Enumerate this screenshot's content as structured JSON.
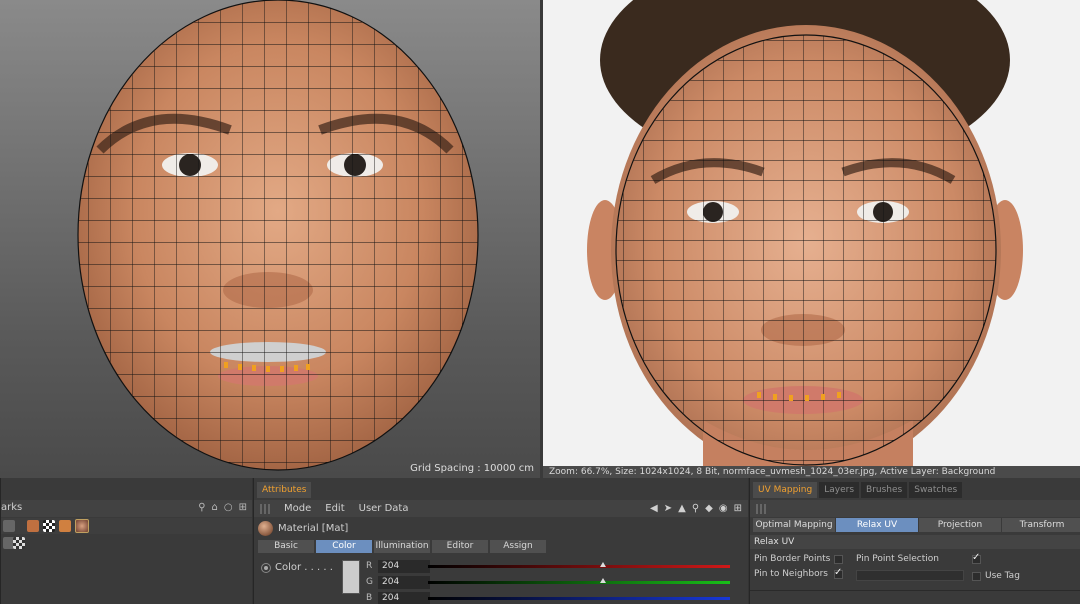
{
  "viewport_left": {
    "grid_spacing": "Grid Spacing : 10000 cm"
  },
  "statusbar": {
    "text": "Zoom: 66.7%, Size: 1024x1024, 8 Bit, normface_uvmesh_1024_03er.jpg, Active Layer: Background"
  },
  "left_panel": {
    "label": "arks"
  },
  "attributes": {
    "tab": "Attributes",
    "menu": [
      "Mode",
      "Edit",
      "User Data"
    ],
    "material": "Material [Mat]",
    "tabs": [
      "Basic",
      "Color",
      "Illumination",
      "Editor",
      "Assign"
    ],
    "selected_tab": "Color",
    "color_label": "Color . . . . .",
    "channels": [
      {
        "name": "R",
        "value": "204",
        "color": "#d01818"
      },
      {
        "name": "G",
        "value": "204",
        "color": "#18c018"
      },
      {
        "name": "B",
        "value": "204",
        "color": "#1838d8"
      }
    ]
  },
  "uv_panel": {
    "tabs": [
      "UV Mapping",
      "Layers",
      "Brushes",
      "Swatches"
    ],
    "subtabs": [
      "Optimal Mapping",
      "Relax UV",
      "Projection",
      "Transform"
    ],
    "selected_subtab": "Relax UV",
    "section": "Relax UV",
    "pin_border": "Pin Border Points",
    "pin_neighbors": "Pin to Neighbors",
    "pin_point_selection": "Pin Point Selection",
    "use_tag": "Use Tag"
  },
  "colors": {
    "accent": "#f0a030",
    "selection": "#6c8fbf",
    "seam_points": "#f0a020"
  }
}
